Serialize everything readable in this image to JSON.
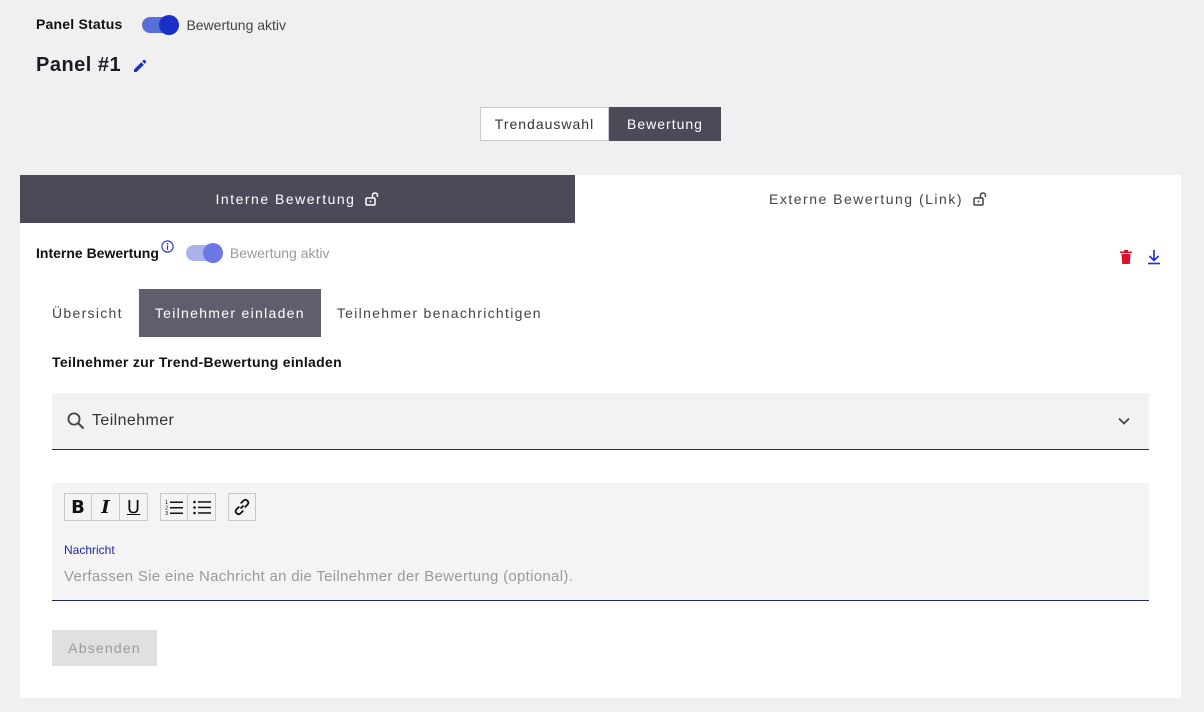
{
  "panel_status": {
    "label": "Panel Status",
    "toggle_label": "Bewertung aktiv",
    "enabled": true
  },
  "panel": {
    "title": "Panel #1"
  },
  "mode_switch": {
    "options": [
      "Trendauswahl",
      "Bewertung"
    ],
    "selected": "Bewertung"
  },
  "main_tabs": [
    {
      "label": "Interne Bewertung",
      "active": true
    },
    {
      "label": "Externe Bewertung (Link)",
      "active": false
    }
  ],
  "internal": {
    "label": "Interne Bewertung",
    "toggle_label": "Bewertung aktiv",
    "enabled": true
  },
  "sub_tabs": [
    {
      "label": "Übersicht",
      "active": false
    },
    {
      "label": "Teilnehmer einladen",
      "active": true
    },
    {
      "label": "Teilnehmer benachrichtigen",
      "active": false
    }
  ],
  "invite": {
    "title": "Teilnehmer zur Trend-Bewertung einladen",
    "search_label": "Teilnehmer",
    "message_label": "Nachricht",
    "message_placeholder": "Verfassen Sie eine Nachricht an die Teilnehmer der Bewertung (optional).",
    "submit_label": "Absenden"
  },
  "toolbar": {
    "bold": "B",
    "italic": "I",
    "underline": "U"
  },
  "colors": {
    "accent": "#1a2fc8",
    "dark": "#4a4a59",
    "delete": "#e0102a"
  }
}
